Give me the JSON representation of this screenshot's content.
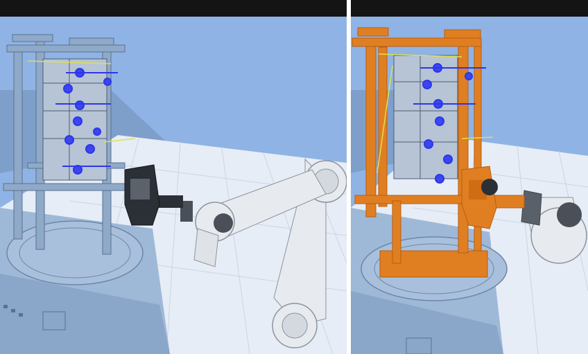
{
  "viewports": [
    {
      "label": "",
      "fixture_color": "#8fa9c9",
      "highlight": ""
    },
    {
      "label": "",
      "fixture_color": "#e07f22",
      "highlight": "#e07f22"
    }
  ],
  "colors": {
    "title_bar": "#141414",
    "background_sky": "#8fb3e4",
    "floor_tile": "#e6edf6",
    "table_blue": "#9eb8d8",
    "robot_white": "#e7eaee",
    "robot_dark": "#4a4f58",
    "fixture_orange": "#e07f22",
    "fixture_orange_dark": "#b85c10",
    "weld_blue": "#2c36e8",
    "guide_yellow": "#dfe14a"
  }
}
